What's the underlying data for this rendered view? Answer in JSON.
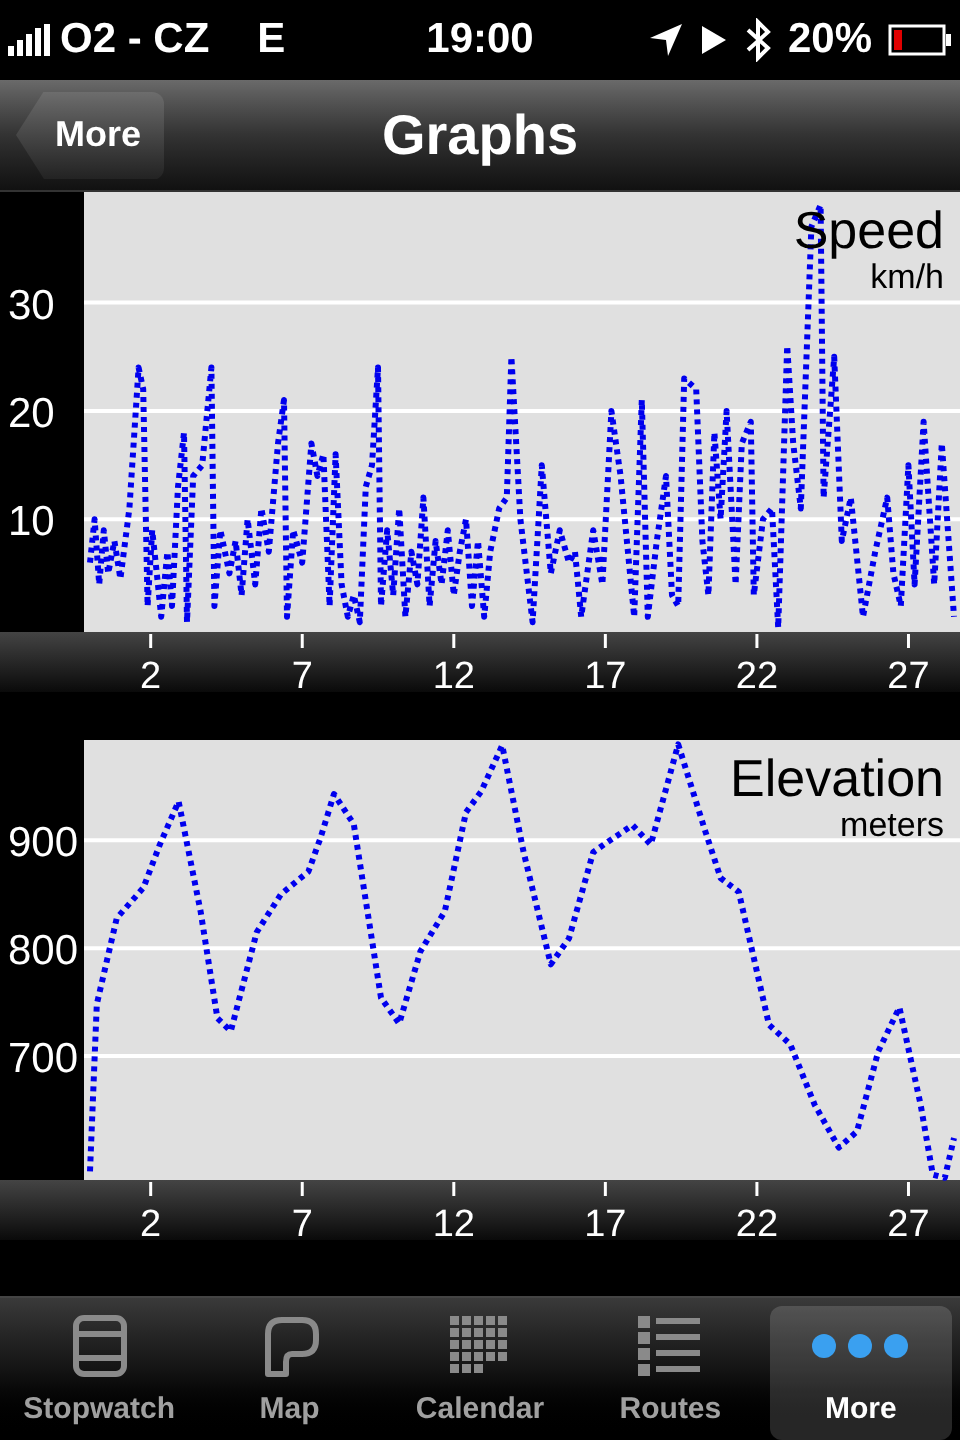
{
  "status_bar": {
    "carrier": "O2 - CZ",
    "network": "E",
    "time": "19:00",
    "battery": "20%"
  },
  "nav_bar": {
    "back_button": "More",
    "title": "Graphs"
  },
  "charts": [
    {
      "chart_data": {
        "type": "line",
        "grid": true,
        "title": "Speed",
        "ylabel": "km/h",
        "xlim": [
          -0.2,
          28.7
        ],
        "ylim": [
          -0.4,
          40.2
        ],
        "xticks": [
          2,
          7,
          12,
          17,
          22,
          27
        ],
        "yticks": [
          10,
          20,
          30
        ],
        "x": [
          0,
          0.15,
          0.3,
          0.45,
          0.6,
          0.8,
          1.0,
          1.3,
          1.6,
          1.75,
          1.9,
          2.05,
          2.2,
          2.35,
          2.55,
          2.7,
          2.9,
          3.1,
          3.2,
          3.4,
          3.7,
          4.0,
          4.1,
          4.3,
          4.6,
          4.8,
          5.0,
          5.2,
          5.45,
          5.65,
          5.9,
          6.2,
          6.4,
          6.5,
          6.7,
          7.0,
          7.3,
          7.5,
          7.7,
          7.9,
          8.1,
          8.3,
          8.5,
          8.7,
          8.9,
          9.1,
          9.3,
          9.5,
          9.6,
          9.8,
          10.0,
          10.2,
          10.4,
          10.6,
          10.8,
          11.0,
          11.2,
          11.4,
          11.6,
          11.8,
          12.0,
          12.2,
          12.4,
          12.6,
          12.8,
          13.0,
          13.2,
          13.5,
          13.75,
          13.9,
          14.2,
          14.6,
          14.9,
          15.2,
          15.5,
          15.8,
          16.0,
          16.2,
          16.6,
          16.9,
          17.2,
          17.5,
          17.95,
          18.2,
          18.4,
          18.7,
          19.0,
          19.2,
          19.4,
          19.6,
          20.0,
          20.2,
          20.4,
          20.6,
          20.8,
          21.0,
          21.3,
          21.5,
          21.8,
          21.9,
          22.2,
          22.5,
          22.7,
          23.0,
          23.2,
          23.45,
          23.8,
          24.1,
          24.2,
          24.55,
          24.8,
          25.1,
          25.5,
          25.9,
          26.3,
          26.5,
          26.75,
          27.0,
          27.2,
          27.5,
          27.85,
          28.1,
          28.5
        ],
        "series": [
          {
            "color": "#0000ee",
            "line_style": "dotted",
            "values": [
              6,
              10,
              4,
              9,
              5,
              8,
              4.5,
              11,
              24,
              22,
              2,
              9,
              5,
              1,
              7,
              2,
              13,
              18,
              0.5,
              14,
              15,
              24,
              2,
              9,
              5,
              8,
              3,
              10,
              4,
              11,
              7,
              17,
              21,
              1,
              9,
              6,
              17,
              14,
              16,
              2,
              16,
              4,
              1,
              3,
              0.5,
              13,
              15,
              24,
              2,
              9,
              3,
              11,
              1,
              7,
              4,
              12,
              2,
              8,
              4,
              9,
              3,
              7,
              10,
              2,
              8,
              1,
              7,
              11,
              12,
              25,
              10,
              0.5,
              15,
              5,
              9,
              6,
              7,
              1,
              9,
              4,
              20,
              14,
              1,
              21,
              1,
              8,
              14,
              3,
              2,
              23,
              22,
              8,
              3,
              18,
              10,
              20,
              4,
              17,
              19,
              3,
              10,
              11,
              0,
              26,
              17,
              11,
              37,
              39,
              12,
              25,
              8,
              12,
              1,
              7,
              12,
              5,
              2,
              15,
              4,
              19,
              4,
              17,
              1
            ]
          }
        ]
      }
    },
    {
      "chart_data": {
        "type": "line",
        "grid": true,
        "title": "Elevation",
        "ylabel": "meters",
        "xlim": [
          -0.2,
          28.7
        ],
        "ylim": [
          585,
          993
        ],
        "xticks": [
          2,
          7,
          12,
          17,
          22,
          27
        ],
        "yticks": [
          700,
          800,
          900
        ],
        "x": [
          0,
          0.22,
          0.88,
          1.76,
          2.3,
          2.92,
          3.65,
          4.2,
          4.64,
          5.5,
          6.3,
          7.2,
          7.6,
          8.05,
          8.7,
          9.6,
          10.2,
          10.9,
          11.7,
          12.4,
          12.9,
          13.6,
          14.3,
          15.2,
          15.8,
          16.6,
          17.1,
          17.9,
          18.5,
          19.4,
          20.3,
          20.8,
          21.4,
          22.4,
          23.1,
          23.9,
          24.7,
          25.3,
          26.0,
          26.7,
          27.4,
          27.8,
          28.2,
          28.5
        ],
        "series": [
          {
            "color": "#0000ee",
            "line_style": "dotted",
            "values": [
              593,
              748,
              828,
              856,
              896,
              936,
              834,
              735,
              723,
              815,
              850,
              871,
              902,
              943,
              915,
              754,
              730,
              797,
              834,
              926,
              945,
              988,
              889,
              785,
              809,
              889,
              899,
              914,
              896,
              989,
              908,
              865,
              852,
              729,
              711,
              655,
              615,
              630,
              704,
              745,
              655,
              590,
              587,
              624
            ]
          }
        ]
      }
    }
  ],
  "tab_bar": [
    {
      "label": "Stopwatch",
      "selected": false
    },
    {
      "label": "Map",
      "selected": false
    },
    {
      "label": "Calendar",
      "selected": false
    },
    {
      "label": "Routes",
      "selected": false
    },
    {
      "label": "More",
      "selected": true
    }
  ]
}
